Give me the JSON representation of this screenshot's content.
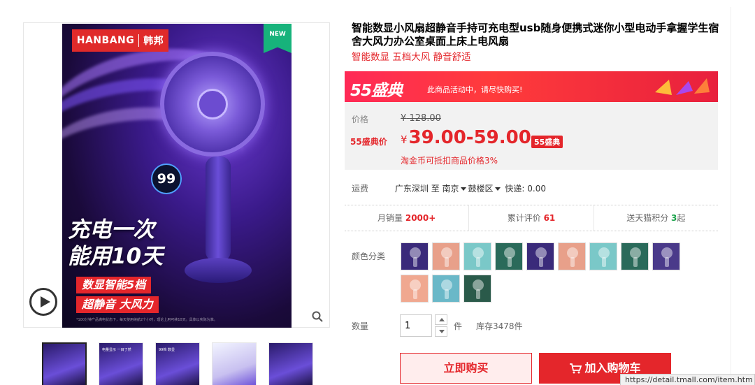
{
  "gallery": {
    "brand_logo_en": "HANBANG",
    "brand_logo_cn": "韩邦",
    "new_badge": "NEW",
    "display_number": "99",
    "promo_line1": "充电一次",
    "promo_line2": "能用10天",
    "promo_tag1": "数显智能5档",
    "promo_tag2": "超静音 大风力",
    "fine_print": "*100分钟产品满电状态下，每天使用续航2个小时，理论上用可续10天。具体以实际为准。",
    "thumbnails": [
      {
        "label": ""
      },
      {
        "label": "电量显示 一目了然"
      },
      {
        "label": "99档 数显"
      },
      {
        "label": ""
      },
      {
        "label": ""
      }
    ]
  },
  "product": {
    "title": "智能数显小风扇超静音手持可充电型usb随身便携式迷你小型电动手拿握学生宿舍大风力办公室桌面上床上电风扇",
    "subtitle": "智能数显 五档大风 静音舒适"
  },
  "promo_banner": {
    "logo": "55盛典",
    "text": "此商品活动中，请尽快购买!"
  },
  "pricing": {
    "price_label": "价格",
    "currency": "¥",
    "original_price": "128.00",
    "sale_label": "55盛典价",
    "sale_price": "39.00-59.00",
    "sale_tag": "55盛典",
    "coin_note": "淘金币可抵扣商品价格3%"
  },
  "shipping": {
    "label": "运费",
    "origin": "广东深圳",
    "to": "至",
    "city": "南京",
    "district": "鼓楼区",
    "express": "快递: 0.00"
  },
  "stats": {
    "monthly_sales_label": "月销量",
    "monthly_sales_value": "2000+",
    "reviews_label": "累计评价",
    "reviews_value": "61",
    "points_label_pre": "送天猫积分",
    "points_value": "3",
    "points_label_post": "起"
  },
  "color": {
    "label": "颜色分类",
    "swatches": [
      "#3a2a7a",
      "#e8a08a",
      "#7ac8c8",
      "#2a6a5a",
      "#3a2a7a",
      "#e8a08a",
      "#7ac8c8",
      "#2a6a5a",
      "#4a3a8a",
      "#f0a890",
      "#6ab8c8",
      "#2a5a4a"
    ]
  },
  "quantity": {
    "label": "数量",
    "value": "1",
    "unit": "件",
    "stock": "库存3478件"
  },
  "actions": {
    "buy_now": "立即购买",
    "add_to_cart": "加入购物车"
  },
  "status_url": "https://detail.tmall.com/item.htm",
  "colors": {
    "accent": "#e4262b",
    "brand_red": "#e02a2a",
    "banner_pink": "#ff2a56",
    "new_badge_green": "#17b37b",
    "points_green": "#1aa34a"
  }
}
